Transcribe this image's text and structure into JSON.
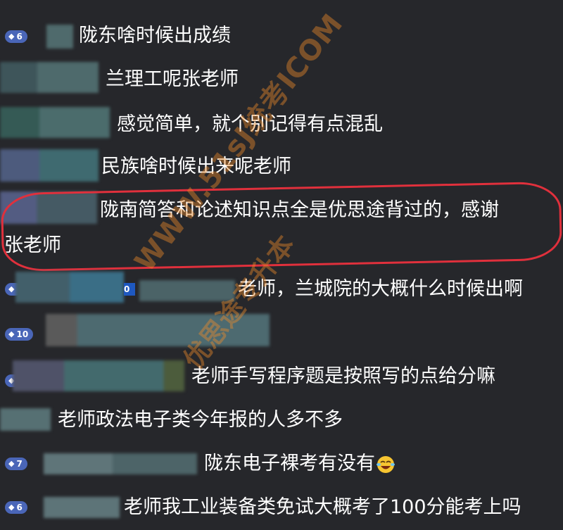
{
  "chat": {
    "messages": [
      {
        "badge": "6",
        "text": "陇东啥时候出成绩"
      },
      {
        "badge": "",
        "text": "兰理工呢张老师"
      },
      {
        "badge": "",
        "text": "感觉简单，就个别记得有点混乱"
      },
      {
        "badge": "",
        "text": "民族啥时候出来呢老师"
      },
      {
        "badge": "",
        "text_line1": "陇南简答和论述知识点全是优思途背过的，感谢",
        "text_line2": "张老师"
      },
      {
        "badge": "",
        "text": "老师，兰城院的大概什么时候出啊"
      },
      {
        "badge": "10",
        "text": ""
      },
      {
        "badge": "",
        "text": "老师手写程序题是按照写的点给分嘛"
      },
      {
        "badge": "",
        "text": "老师政法电子类今年报的人多不多"
      },
      {
        "badge": "7",
        "text": "陇东电子裸考有没有"
      },
      {
        "badge": "6",
        "text": "老师我工业装备类免试大概考了100分能考上吗"
      }
    ]
  },
  "watermark": {
    "line1": "WWW.51sJ统考ICOM",
    "line2": "优思途专升本"
  },
  "icons": {
    "badge_gem": "diamond-icon",
    "emoji": "laughing-emoji-icon"
  },
  "colors": {
    "background": "#26272b",
    "badge": "#4a66b8",
    "highlight_circle": "#e0303c",
    "watermark": "#f08c28"
  }
}
